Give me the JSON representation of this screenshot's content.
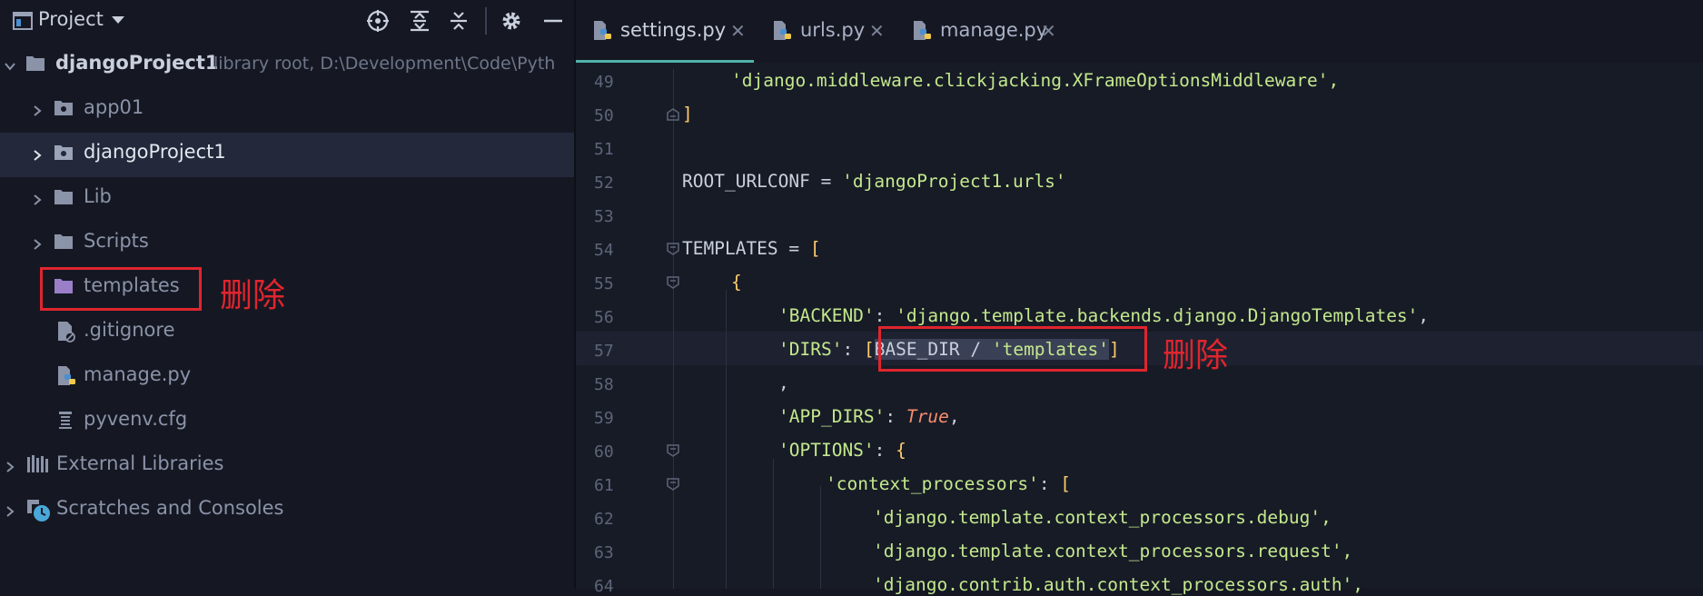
{
  "project_panel": {
    "title": "Project",
    "tree": [
      {
        "label": "djangoProject1",
        "sub": "library root,  D:\\Development\\Code\\Pyth"
      },
      {
        "label": "app01"
      },
      {
        "label": "djangoProject1"
      },
      {
        "label": "Lib"
      },
      {
        "label": "Scripts"
      },
      {
        "label": "templates"
      },
      {
        "label": ".gitignore"
      },
      {
        "label": "manage.py"
      },
      {
        "label": "pyvenv.cfg"
      },
      {
        "label": "External Libraries"
      },
      {
        "label": "Scratches and Consoles"
      }
    ]
  },
  "tabs": [
    {
      "label": "settings.py",
      "active": true
    },
    {
      "label": "urls.py",
      "active": false
    },
    {
      "label": "manage.py",
      "active": false
    }
  ],
  "line_numbers": [
    "49",
    "50",
    "51",
    "52",
    "53",
    "54",
    "55",
    "56",
    "57",
    "58",
    "59",
    "60",
    "61",
    "62",
    "63",
    "64"
  ],
  "code": {
    "l49": "'django.middleware.clickjacking.XFrameOptionsMiddleware',",
    "l50": "]",
    "l52_name": "ROOT_URLCONF",
    "l52_op": " = ",
    "l52_str": "'djangoProject1.urls'",
    "l54_name": "TEMPLATES",
    "l54_op": " = ",
    "l54_br": "[",
    "l55": "{",
    "l56_key": "'BACKEND'",
    "l56_colon": ": ",
    "l56_val": "'django.template.backends.django.DjangoTemplates'",
    "l56_end": ",",
    "l57_key": "'DIRS'",
    "l57_colon": ": ",
    "l57_open": "[",
    "l57_name": "BASE_DIR",
    "l57_op": " / ",
    "l57_val": "'templates'",
    "l57_close": "]",
    "l58": ",",
    "l59_key": "'APP_DIRS'",
    "l59_colon": ": ",
    "l59_val": "True",
    "l59_end": ",",
    "l60_key": "'OPTIONS'",
    "l60_colon": ": ",
    "l60_br": "{",
    "l61_key": "'context_processors'",
    "l61_colon": ": ",
    "l61_br": "[",
    "l62": "'django.template.context_processors.debug',",
    "l63": "'django.template.context_processors.request',",
    "l64": "'django.contrib.auth.context_processors.auth',"
  },
  "annotations": {
    "delete_left": "删除",
    "delete_right": "删除"
  },
  "colors": {
    "annotation_red": "#e0252e",
    "active_tab_underline": "#4fb3a9",
    "string_green": "#c3e88d",
    "keyword_orange": "#f78c6c"
  }
}
